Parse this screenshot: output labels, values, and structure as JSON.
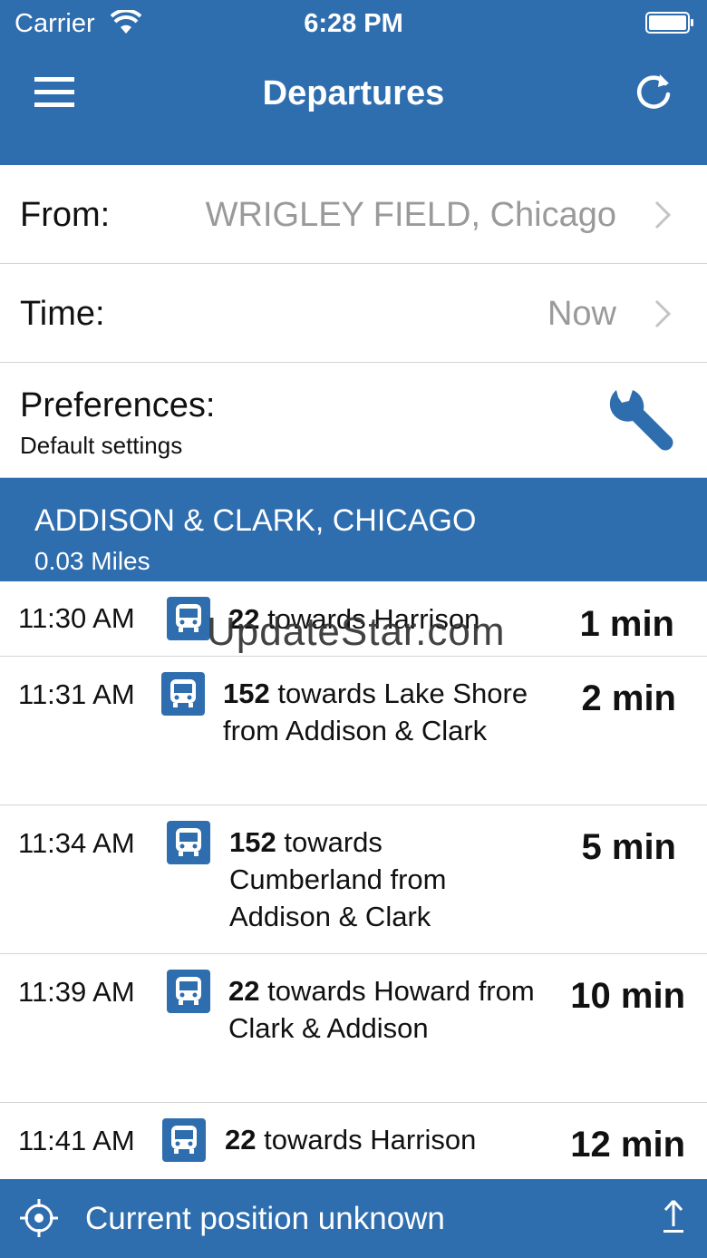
{
  "status_bar": {
    "carrier": "Carrier",
    "time": "6:28 PM"
  },
  "header": {
    "title": "Departures",
    "menu_icon": "hamburger-icon",
    "refresh_icon": "refresh-icon"
  },
  "form": {
    "from_label": "From:",
    "from_value": "WRIGLEY FIELD, Chicago",
    "time_label": "Time:",
    "time_value": "Now",
    "preferences_label": "Preferences:",
    "preferences_value": "Default settings"
  },
  "stop": {
    "name": "ADDISON & CLARK, CHICAGO",
    "distance": "0.03 Miles"
  },
  "departures": [
    {
      "time": "11:30 AM",
      "route": "22",
      "desc": " towards Harrison",
      "mins": "1 min"
    },
    {
      "time": "11:31 AM",
      "route": "152",
      "desc": " towards Lake Shore from Addison & Clark",
      "mins": "2 min"
    },
    {
      "time": "11:34 AM",
      "route": "152",
      "desc": " towards Cumberland from Addison & Clark",
      "mins": "5 min"
    },
    {
      "time": "11:39 AM",
      "route": "22",
      "desc": " towards Howard from Clark & Addison",
      "mins": "10 min"
    },
    {
      "time": "11:41 AM",
      "route": "22",
      "desc": " towards Harrison",
      "mins": "12 min"
    }
  ],
  "watermark": "UpdateStar.com",
  "footer": {
    "text": "Current position unknown",
    "locate_icon": "crosshair-icon",
    "share_icon": "share-icon"
  },
  "colors": {
    "brand_blue": "#2E6DAE",
    "muted_text": "#9a9a9a"
  }
}
